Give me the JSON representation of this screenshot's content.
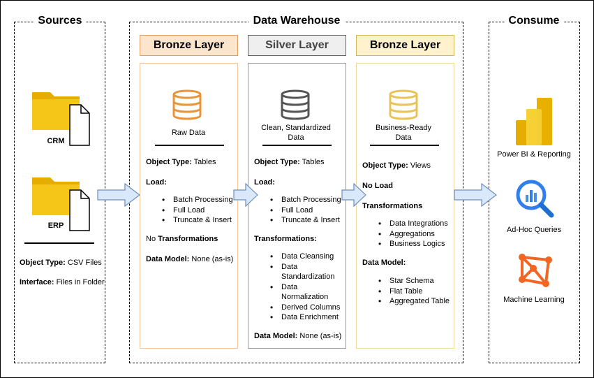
{
  "sources": {
    "title": "Sources",
    "crm_label": "CRM",
    "erp_label": "ERP",
    "object_type_key": "Object Type:",
    "object_type_value": " CSV Files",
    "interface_key": "Interface:",
    "interface_value": " Files in Folder"
  },
  "warehouse": {
    "title": "Data Warehouse",
    "bronze": {
      "header": "Bronze Layer",
      "icon_label": "Raw Data",
      "object_type_key": "Object Type:",
      "object_type_value": " Tables",
      "load_key": "Load:",
      "load_items": [
        "Batch Processing",
        "Full Load",
        "Truncate & Insert"
      ],
      "no_prefix": "No ",
      "transformations_key": "Transformations",
      "data_model_key": "Data Model:",
      "data_model_value": " None (as-is)"
    },
    "silver": {
      "header": "Silver Layer",
      "icon_label_1": "Clean, Standardized",
      "icon_label_2": "Data",
      "object_type_key": "Object Type:",
      "object_type_value": " Tables",
      "load_key": "Load:",
      "load_items": [
        "Batch Processing",
        "Full Load",
        "Truncate & Insert"
      ],
      "transformations_key": "Transformations:",
      "transformation_items": [
        "Data Cleansing",
        "Data Standardization",
        "Data Normalization",
        "Derived Columns",
        "Data Enrichment"
      ],
      "data_model_key": "Data Model:",
      "data_model_value": " None (as-is)"
    },
    "gold": {
      "header": "Bronze Layer",
      "icon_label_1": "Business-Ready",
      "icon_label_2": "Data",
      "object_type_key": "Object Type:",
      "object_type_value": " Views",
      "no_load": "No Load",
      "transformations_key": "Transformations",
      "transformation_items": [
        "Data Integrations",
        "Aggregations",
        "Business Logics"
      ],
      "data_model_key": "Data Model:",
      "data_model_items": [
        "Star Schema",
        "Flat Table",
        "Aggregated Table"
      ]
    }
  },
  "consume": {
    "title": "Consume",
    "items": [
      "Power BI & Reporting",
      "Ad-Hoc Queries",
      "Machine Learning"
    ]
  },
  "colors": {
    "bronze_fill": "#fce5cd",
    "bronze_border": "#e0a060",
    "silver_fill": "#efefef",
    "silver_border": "#666666",
    "gold_fill": "#fff2cc",
    "gold_border": "#d6b656",
    "arrow_fill": "#dae8fc",
    "arrow_stroke": "#6c8ebf",
    "folder": "#f5c518",
    "powerbi": "#f2c811",
    "query_blue": "#2f80ed",
    "ml_orange": "#f26522"
  },
  "icons": [
    "folder-icon",
    "document-icon",
    "database-icon",
    "power-bi-icon",
    "search-chart-icon",
    "machine-learning-icon",
    "arrow-right-icon"
  ]
}
